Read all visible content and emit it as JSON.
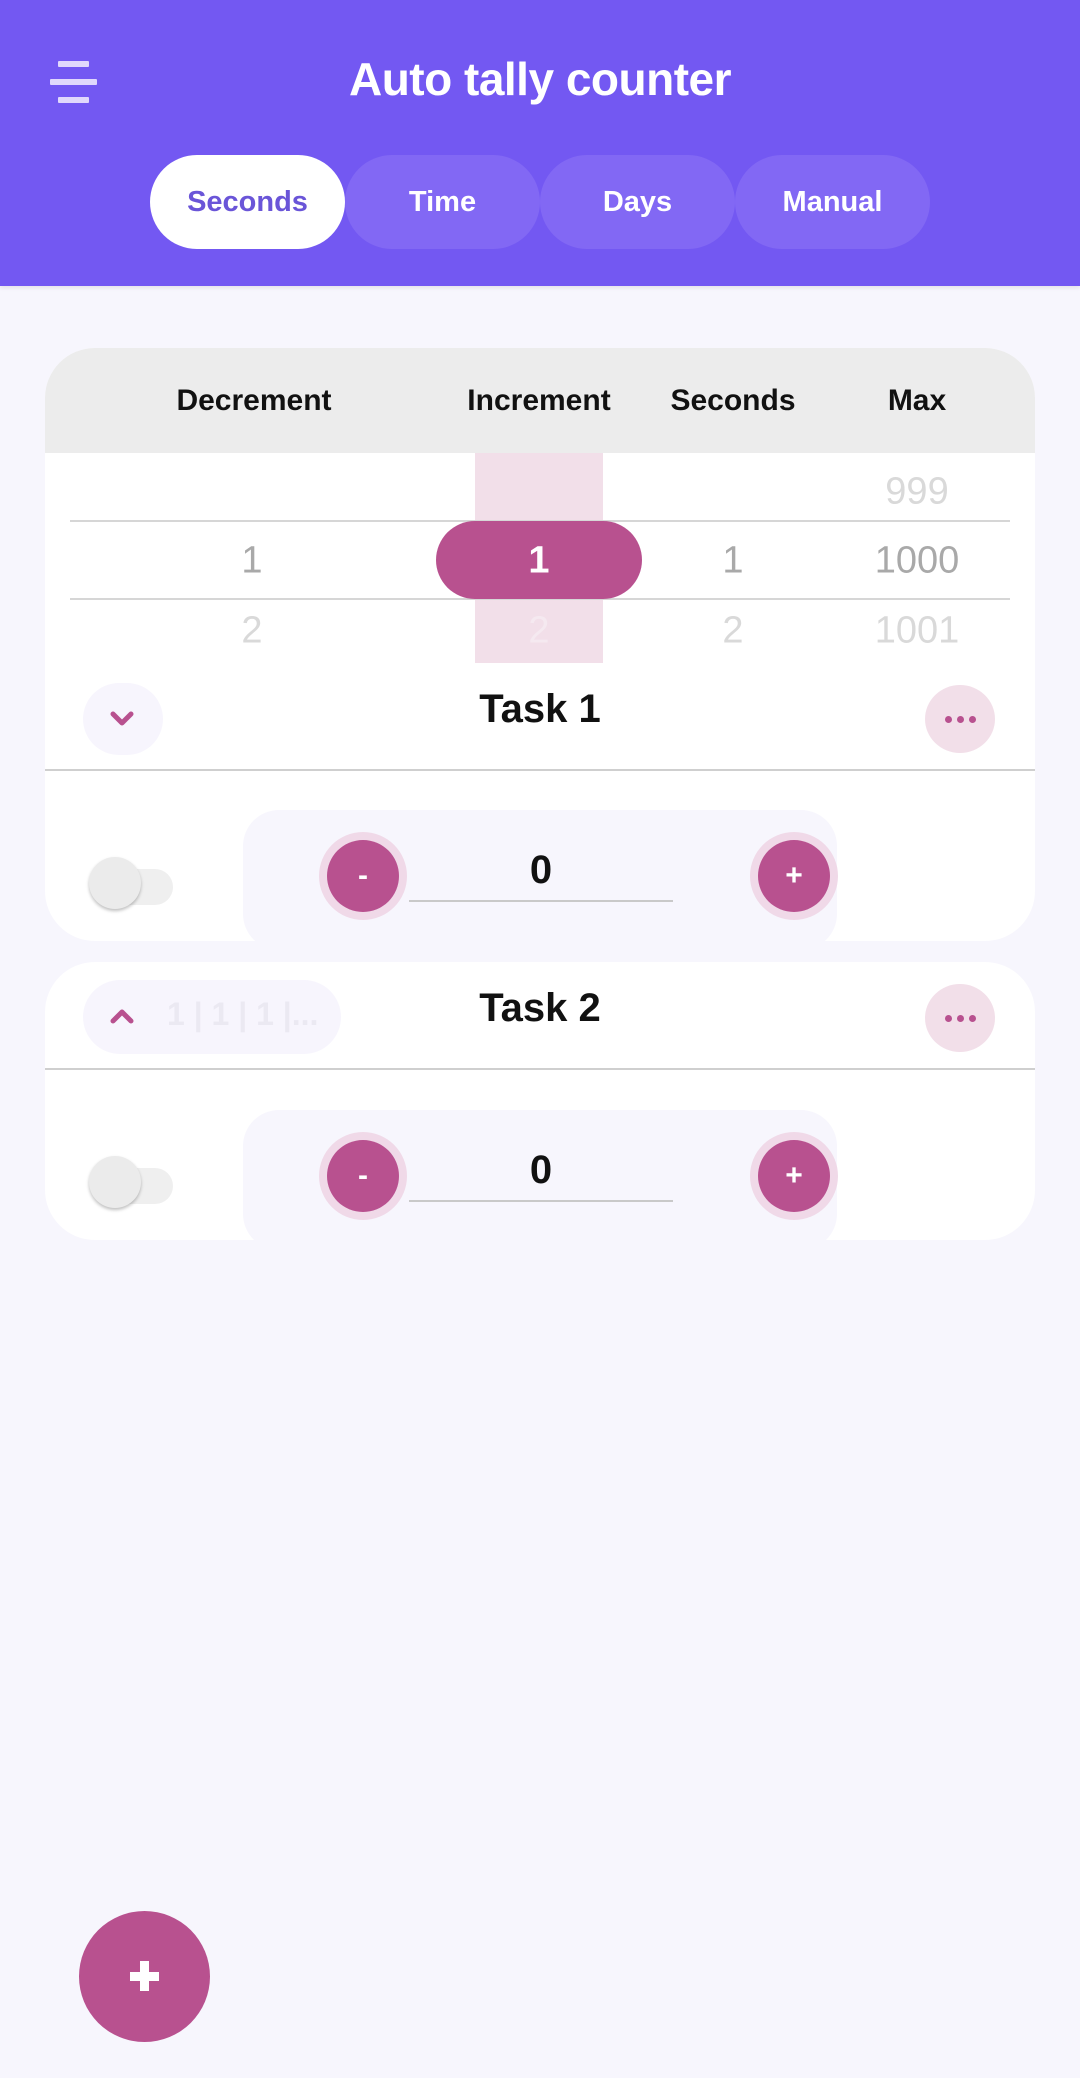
{
  "header": {
    "title": "Auto tally counter",
    "menu_icon": "hamburger-menu-icon"
  },
  "tabs": [
    {
      "label": "Seconds",
      "active": true
    },
    {
      "label": "Time",
      "active": false
    },
    {
      "label": "Days",
      "active": false
    },
    {
      "label": "Manual",
      "active": false
    }
  ],
  "picker": {
    "columns": [
      "Decrement",
      "Increment",
      "Seconds",
      "Max"
    ],
    "rows": {
      "above": [
        "",
        "",
        "",
        "999"
      ],
      "selected": [
        "1",
        "1",
        "1",
        "1000"
      ],
      "below": [
        "2",
        "2",
        "2",
        "1001"
      ]
    }
  },
  "tasks": [
    {
      "title": "Task 1",
      "expanded": true,
      "collapse_icon": "chevron-down-icon",
      "summary": "",
      "count": "0",
      "minus_label": "-",
      "plus_label": "+",
      "auto_enabled": false
    },
    {
      "title": "Task 2",
      "expanded": false,
      "collapse_icon": "chevron-up-icon",
      "summary": "1 | 1 | 1 |...",
      "count": "0",
      "minus_label": "-",
      "plus_label": "+",
      "auto_enabled": false
    }
  ],
  "fab": {
    "icon": "plus-icon"
  },
  "colors": {
    "primary": "#7358f2",
    "accent": "#b8518f",
    "accent_light": "#f2dfe9",
    "background": "#f7f6fd"
  }
}
